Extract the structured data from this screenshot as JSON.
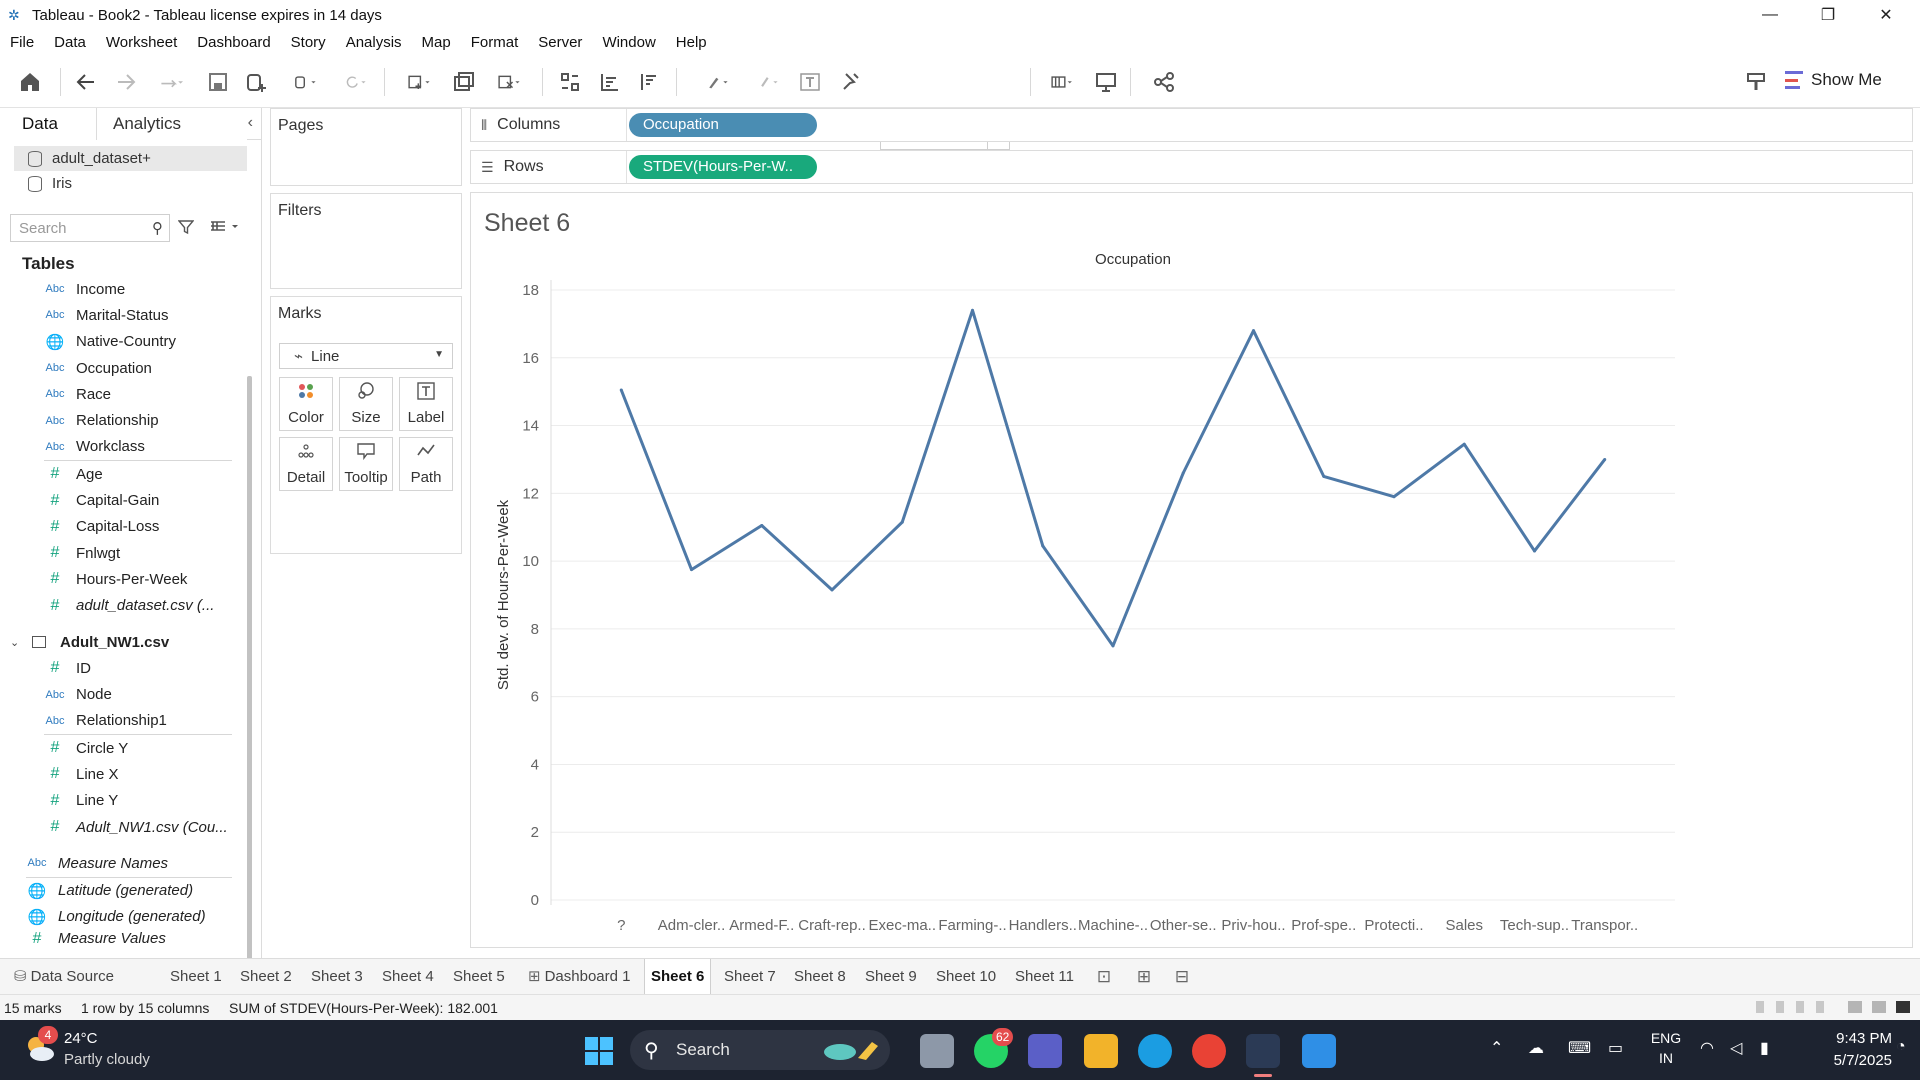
{
  "window": {
    "title": "Tableau - Book2 - Tableau license expires in 14 days",
    "minimize": "—",
    "restore": "❐",
    "close": "✕"
  },
  "menu": [
    "File",
    "Data",
    "Worksheet",
    "Dashboard",
    "Story",
    "Analysis",
    "Map",
    "Format",
    "Server",
    "Window",
    "Help"
  ],
  "toolbar": {
    "fit_value": "Standard",
    "show_me_label": "Show Me"
  },
  "data_pane": {
    "tab_data": "Data",
    "tab_analytics": "Analytics",
    "collapse": "‹",
    "datasources": [
      {
        "name": "adult_dataset+",
        "selected": true
      },
      {
        "name": "Iris",
        "selected": false
      }
    ],
    "search_placeholder": "Search",
    "tables_heading": "Tables",
    "dimensions": [
      {
        "type": "Abc",
        "name": "Income"
      },
      {
        "type": "Abc",
        "name": "Marital-Status"
      },
      {
        "type": "geo",
        "name": "Native-Country"
      },
      {
        "type": "Abc",
        "name": "Occupation"
      },
      {
        "type": "Abc",
        "name": "Race"
      },
      {
        "type": "Abc",
        "name": "Relationship"
      },
      {
        "type": "Abc",
        "name": "Workclass"
      }
    ],
    "measures": [
      {
        "type": "#",
        "name": "Age"
      },
      {
        "type": "#",
        "name": "Capital-Gain"
      },
      {
        "type": "#",
        "name": "Capital-Loss"
      },
      {
        "type": "#",
        "name": "Fnlwgt"
      },
      {
        "type": "#",
        "name": "Hours-Per-Week"
      },
      {
        "type": "#",
        "name": "adult_dataset.csv (..."
      }
    ],
    "group2_name": "Adult_NW1.csv",
    "group2_dimensions": [
      {
        "type": "#",
        "name": "ID"
      },
      {
        "type": "Abc",
        "name": "Node"
      },
      {
        "type": "Abc",
        "name": "Relationship1"
      }
    ],
    "group2_measures": [
      {
        "type": "#",
        "name": "Circle Y"
      },
      {
        "type": "#",
        "name": "Line X"
      },
      {
        "type": "#",
        "name": "Line Y"
      },
      {
        "type": "#",
        "name": "Adult_NW1.csv (Cou..."
      }
    ],
    "extra_fields": [
      {
        "type": "Abc",
        "name": "Measure Names"
      },
      {
        "type": "geo",
        "name": "Latitude (generated)"
      },
      {
        "type": "geo",
        "name": "Longitude (generated)"
      },
      {
        "type": "#",
        "name": "Measure Values"
      }
    ]
  },
  "cards": {
    "pages": "Pages",
    "filters": "Filters",
    "marks": "Marks",
    "marks_type": "Line",
    "mark_buttons": [
      "Color",
      "Size",
      "Label",
      "Detail",
      "Tooltip",
      "Path"
    ]
  },
  "shelves": {
    "columns_label": "Columns",
    "columns_pill": "Occupation",
    "rows_label": "Rows",
    "rows_pill": "STDEV(Hours-Per-W..",
    "columns_color": "#4a8db3",
    "rows_color": "#19a97c"
  },
  "view": {
    "sheet_title": "Sheet 6"
  },
  "chart_data": {
    "type": "line",
    "title": "Occupation",
    "ylabel": "Std. dev. of Hours-Per-Week",
    "xlabel": "",
    "categories": [
      "?",
      "Adm-cler..",
      "Armed-F..",
      "Craft-rep..",
      "Exec-ma..",
      "Farming-..",
      "Handlers..",
      "Machine-..",
      "Other-se..",
      "Priv-hou..",
      "Prof-spe..",
      "Protecti..",
      "Sales",
      "Tech-sup..",
      "Transpor.."
    ],
    "series": [
      {
        "values": [
          15.05,
          9.75,
          11.05,
          9.15,
          11.15,
          17.4,
          10.45,
          7.5,
          12.6,
          16.8,
          12.5,
          11.9,
          13.45,
          10.3,
          13.0
        ]
      }
    ],
    "ylim": [
      0,
      18
    ],
    "yticks": [
      0,
      2,
      4,
      6,
      8,
      10,
      12,
      14,
      16,
      18
    ],
    "grid": true,
    "line_color": "#4e79a7"
  },
  "sheet_tabs": {
    "data_source": "Data Source",
    "tabs": [
      "Sheet 1",
      "Sheet 2",
      "Sheet 3",
      "Sheet 4",
      "Sheet 5",
      "Dashboard 1",
      "Sheet 6",
      "Sheet 7",
      "Sheet 8",
      "Sheet 9",
      "Sheet 10",
      "Sheet 11"
    ],
    "active": "Sheet 6"
  },
  "status": {
    "marks": "15 marks",
    "layout": "1 row by 15 columns",
    "sum": "SUM of STDEV(Hours-Per-Week): 182.001"
  },
  "taskbar": {
    "weather_temp": "24°C",
    "weather_desc": "Partly cloudy",
    "weather_badge": "4",
    "search_label": "Search",
    "whatsapp_badge": "62",
    "lang_top": "ENG",
    "lang_bottom": "IN",
    "time": "9:43 PM",
    "date": "5/7/2025"
  }
}
